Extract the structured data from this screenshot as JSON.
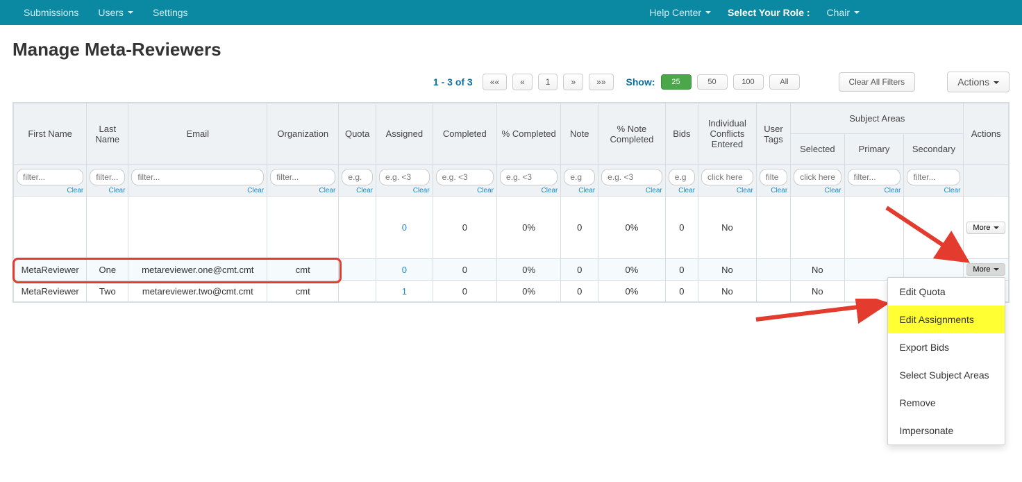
{
  "nav": {
    "submissions": "Submissions",
    "users": "Users",
    "settings": "Settings",
    "help": "Help Center",
    "role_label": "Select Your Role :",
    "role_value": "Chair"
  },
  "title": "Manage Meta-Reviewers",
  "pager": {
    "info": "1 - 3 of 3",
    "first": "««",
    "prev": "«",
    "page": "1",
    "next": "»",
    "last": "»»"
  },
  "show": {
    "label": "Show:",
    "s25": "25",
    "s50": "50",
    "s100": "100",
    "sAll": "All"
  },
  "buttons": {
    "clear_all": "Clear All Filters",
    "actions": "Actions"
  },
  "columns": {
    "first_name": "First Name",
    "last_name": "Last Name",
    "email": "Email",
    "organization": "Organization",
    "quota": "Quota",
    "assigned": "Assigned",
    "completed": "Completed",
    "pct_completed": "% Completed",
    "note": "Note",
    "pct_note": "% Note Completed",
    "bids": "Bids",
    "ice": "Individual Conflicts Entered",
    "user_tags": "User Tags",
    "subject_group": "Subject Areas",
    "selected": "Selected",
    "primary": "Primary",
    "secondary": "Secondary",
    "actions": "Actions"
  },
  "filters": {
    "generic": "filter...",
    "eg_gt": "e.g. <3",
    "eg_short": "e.g.",
    "eg": "e.g",
    "click": "click here",
    "filte": "filte",
    "clear": "Clear"
  },
  "rows": [
    {
      "first_name": "",
      "last_name": "",
      "email": "",
      "org": "",
      "quota": "",
      "assigned": "0",
      "completed": "0",
      "pct_completed": "0%",
      "note": "0",
      "pct_note": "0%",
      "bids": "0",
      "ice": "No",
      "user_tags": "",
      "selected": "",
      "primary": "",
      "secondary": "",
      "blurred": true
    },
    {
      "first_name": "MetaReviewer",
      "last_name": "One",
      "email": "metareviewer.one@cmt.cmt",
      "org": "cmt",
      "quota": "",
      "assigned": "0",
      "completed": "0",
      "pct_completed": "0%",
      "note": "0",
      "pct_note": "0%",
      "bids": "0",
      "ice": "No",
      "user_tags": "",
      "selected": "No",
      "primary": "",
      "secondary": ""
    },
    {
      "first_name": "MetaReviewer",
      "last_name": "Two",
      "email": "metareviewer.two@cmt.cmt",
      "org": "cmt",
      "quota": "",
      "assigned": "1",
      "completed": "0",
      "pct_completed": "0%",
      "note": "0",
      "pct_note": "0%",
      "bids": "0",
      "ice": "No",
      "user_tags": "",
      "selected": "No",
      "primary": "",
      "secondary": ""
    }
  ],
  "more_label": "More",
  "dropdown": {
    "edit_quota": "Edit Quota",
    "edit_assignments": "Edit Assignments",
    "export_bids": "Export Bids",
    "select_subject": "Select Subject Areas",
    "remove": "Remove",
    "impersonate": "Impersonate"
  }
}
